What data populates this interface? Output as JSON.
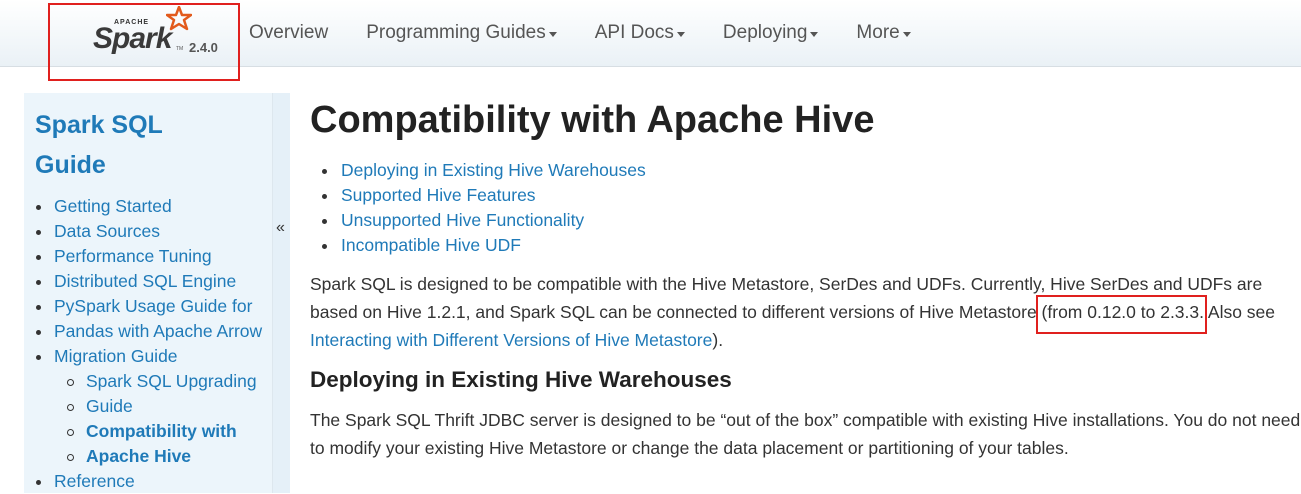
{
  "navbar": {
    "logo": {
      "apache": "APACHE",
      "spark": "Spark",
      "tm": "TM",
      "version": "2.4.0"
    },
    "items": [
      {
        "label": "Overview"
      },
      {
        "label": "Programming Guides"
      },
      {
        "label": "API Docs"
      },
      {
        "label": "Deploying"
      },
      {
        "label": "More"
      }
    ]
  },
  "sidebar": {
    "title_line1": "Spark SQL",
    "title_line2": "Guide",
    "collapse_label": "«",
    "items": [
      {
        "label": "Getting Started"
      },
      {
        "label": "Data Sources"
      },
      {
        "label": "Performance Tuning"
      },
      {
        "label": "Distributed SQL Engine"
      },
      {
        "label": "PySpark Usage Guide for"
      },
      {
        "label": "Pandas with Apache Arrow"
      },
      {
        "label": "Migration Guide"
      },
      {
        "label": "Spark SQL Upgrading"
      },
      {
        "label": "Guide"
      },
      {
        "label": "Compatibility with"
      },
      {
        "label": "Apache Hive"
      },
      {
        "label": "Reference"
      }
    ]
  },
  "main": {
    "title": "Compatibility with Apache Hive",
    "toc": [
      {
        "label": "Deploying in Existing Hive Warehouses"
      },
      {
        "label": "Supported Hive Features"
      },
      {
        "label": "Unsupported Hive Functionality"
      },
      {
        "label": "Incompatible Hive UDF"
      }
    ],
    "intro": {
      "line1": "Spark SQL is designed to be compatible with the Hive Metastore, SerDes and UDFs. Currently, Hive SerDes and UDFs are",
      "line2_a": "based on Hive 1.2.1, and Spark SQL can be connected to different versions of Hive Metastore ",
      "line2_highlight": "(from 0.12.0 to 2.3.3.",
      "line2_b": " Also see",
      "link": "Interacting with Different Versions of Hive Metastore",
      "line3_tail": ")."
    },
    "section_title": "Deploying in Existing Hive Warehouses",
    "section_text": {
      "line1": "The Spark SQL Thrift JDBC server is designed to be “out of the box” compatible with existing Hive installations. You do not need",
      "line2": "to modify your existing Hive Metastore or change the data placement or partitioning of your tables."
    }
  },
  "colors": {
    "link": "#1f7ab8",
    "highlight_box": "#e0201e",
    "logo_star": "#e25a1c"
  }
}
